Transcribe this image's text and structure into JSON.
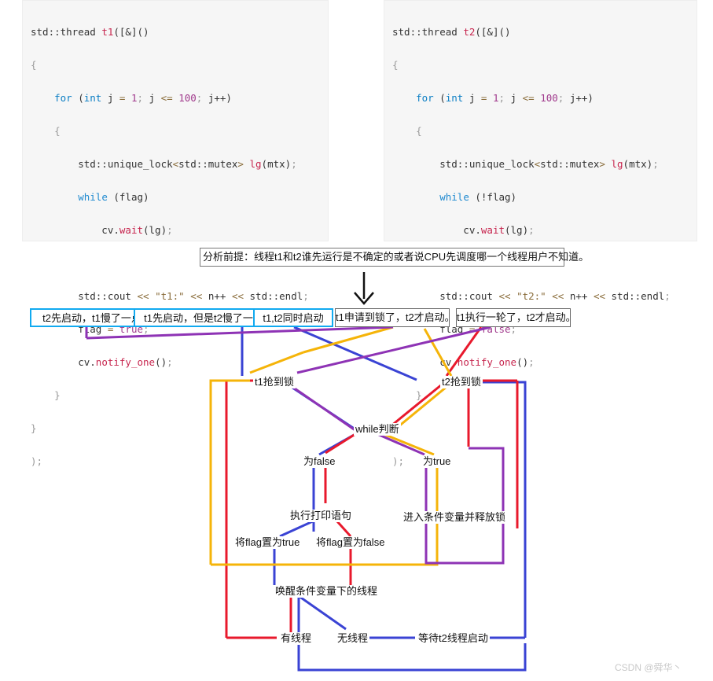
{
  "code_left": {
    "name": "thread-t1-code",
    "lines": [
      "std::thread t1([&]()",
      "{",
      "    for (int j = 1; j <= 100; j++)",
      "    {",
      "        std::unique_lock<std::mutex> lg(mtx);",
      "        while (flag)",
      "            cv.wait(lg);",
      "",
      "        std::cout << \"t1:\" << n++ << std::endl;",
      "        flag = true;",
      "        cv.notify_one();",
      "    }",
      "}",
      ");"
    ]
  },
  "code_right": {
    "name": "thread-t2-code",
    "lines": [
      "std::thread t2([&]()",
      "{",
      "    for (int j = 1; j <= 100; j++)",
      "    {",
      "        std::unique_lock<std::mutex> lg(mtx);",
      "        while (!flag)",
      "            cv.wait(lg);",
      "",
      "        std::cout << \"t2:\" << n++ << std::endl;",
      "        flag = false;",
      "        cv.notify_one();",
      "    }",
      "}",
      ");"
    ]
  },
  "premise": {
    "text": "分析前提：线程t1和t2谁先运行是不确定的或者说CPU先调度哪一个线程用户不知道。"
  },
  "arrow": {
    "icon": "arrow-down-icon"
  },
  "cases": [
    {
      "id": "case1",
      "label": "t2先启动，t1慢了一点",
      "style": "blue",
      "color": "#11aaf0"
    },
    {
      "id": "case2",
      "label": "t1先启动，但是t2慢了一点",
      "style": "blue",
      "color": "#11aaf0"
    },
    {
      "id": "case3",
      "label": "t1,t2同时启动",
      "style": "blue",
      "color": "#11aaf0"
    },
    {
      "id": "case4",
      "label": "t1申请到锁了，t2才启动。",
      "style": "gray",
      "color": "#666666"
    },
    {
      "id": "case5",
      "label": "t1执行一轮了，t2才启动。",
      "style": "gray",
      "color": "#666666"
    }
  ],
  "nodes": {
    "t1_lock": "t1抢到锁",
    "t2_lock": "t2抢到锁",
    "while_check": "while判断",
    "is_false": "为false",
    "is_true": "为true",
    "do_print": "执行打印语句",
    "enter_cv": "进入条件变量并释放锁",
    "set_true": "将flag置为true",
    "set_false": "将flag置为false",
    "notify": "唤醒条件变量下的线程",
    "has_thread": "有线程",
    "no_thread": "无线程",
    "wait_t2": "等待t2线程启动"
  },
  "wire_colors": {
    "red": "#e8192c",
    "blue": "#3a43d4",
    "yellow": "#f5b409",
    "purple": "#8e33b5",
    "box_blue": "#11aaf0",
    "box_gray": "#666666"
  },
  "watermark": {
    "text": "CSDN @舜华丶"
  }
}
